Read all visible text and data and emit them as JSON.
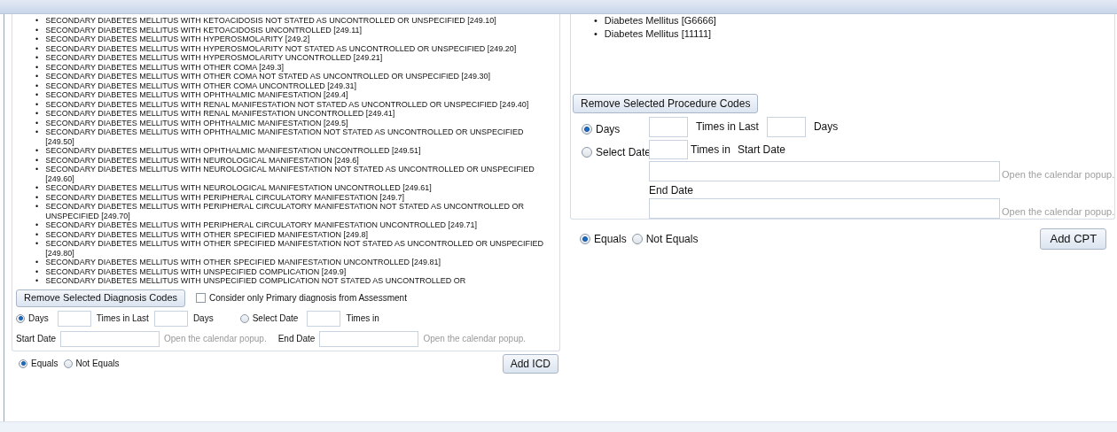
{
  "diagnosis_panel": {
    "codes": [
      {
        "marker": "•",
        "label": "SECONDARY DIABETES MELLITUS WITH KETOACIDOSIS NOT STATED AS UNCONTROLLED OR UNSPECIFIED [249.10]"
      },
      {
        "marker": "•",
        "label": "SECONDARY DIABETES MELLITUS WITH KETOACIDOSIS UNCONTROLLED [249.11]"
      },
      {
        "marker": "•",
        "label": "SECONDARY DIABETES MELLITUS WITH HYPEROSMOLARITY [249.2]"
      },
      {
        "marker": "•",
        "label": "SECONDARY DIABETES MELLITUS WITH HYPEROSMOLARITY NOT STATED AS UNCONTROLLED OR UNSPECIFIED [249.20]"
      },
      {
        "marker": "•",
        "label": "SECONDARY DIABETES MELLITUS WITH HYPEROSMOLARITY UNCONTROLLED [249.21]"
      },
      {
        "marker": "•",
        "label": "SECONDARY DIABETES MELLITUS WITH OTHER COMA [249.3]"
      },
      {
        "marker": "•",
        "label": "SECONDARY DIABETES MELLITUS WITH OTHER COMA NOT STATED AS UNCONTROLLED OR UNSPECIFIED [249.30]"
      },
      {
        "marker": "•",
        "label": "SECONDARY DIABETES MELLITUS WITH OTHER COMA UNCONTROLLED [249.31]"
      },
      {
        "marker": "•",
        "label": "SECONDARY DIABETES MELLITUS WITH OPHTHALMIC MANIFESTATION [249.4]"
      },
      {
        "marker": "•",
        "label": "SECONDARY DIABETES MELLITUS WITH RENAL MANIFESTATION NOT STATED AS UNCONTROLLED OR UNSPECIFIED [249.40]"
      },
      {
        "marker": "•",
        "label": "SECONDARY DIABETES MELLITUS WITH RENAL MANIFESTATION UNCONTROLLED [249.41]"
      },
      {
        "marker": "•",
        "label": "SECONDARY DIABETES MELLITUS WITH OPHTHALMIC MANIFESTATION [249.5]"
      },
      {
        "marker": "•",
        "label": "SECONDARY DIABETES MELLITUS WITH OPHTHALMIC MANIFESTATION NOT STATED AS UNCONTROLLED OR UNSPECIFIED [249.50]"
      },
      {
        "marker": "•",
        "label": "SECONDARY DIABETES MELLITUS WITH OPHTHALMIC MANIFESTATION UNCONTROLLED [249.51]"
      },
      {
        "marker": "•",
        "label": "SECONDARY DIABETES MELLITUS WITH NEUROLOGICAL MANIFESTATION [249.6]"
      },
      {
        "marker": "•",
        "label": "SECONDARY DIABETES MELLITUS WITH NEUROLOGICAL MANIFESTATION NOT STATED AS UNCONTROLLED OR UNSPECIFIED [249.60]"
      },
      {
        "marker": "•",
        "label": "SECONDARY DIABETES MELLITUS WITH NEUROLOGICAL MANIFESTATION UNCONTROLLED [249.61]"
      },
      {
        "marker": "•",
        "label": "SECONDARY DIABETES MELLITUS WITH PERIPHERAL CIRCULATORY MANIFESTATION [249.7]"
      },
      {
        "marker": "•",
        "label": "SECONDARY DIABETES MELLITUS WITH PERIPHERAL CIRCULATORY MANIFESTATION NOT STATED AS UNCONTROLLED OR UNSPECIFIED [249.70]"
      },
      {
        "marker": "•",
        "label": "SECONDARY DIABETES MELLITUS WITH PERIPHERAL CIRCULATORY MANIFESTATION UNCONTROLLED [249.71]"
      },
      {
        "marker": "•",
        "label": "SECONDARY DIABETES MELLITUS WITH OTHER SPECIFIED MANIFESTATION [249.8]"
      },
      {
        "marker": "•",
        "label": "SECONDARY DIABETES MELLITUS WITH OTHER SPECIFIED MANIFESTATION NOT STATED AS UNCONTROLLED OR UNSPECIFIED [249.80]"
      },
      {
        "marker": "•",
        "label": "SECONDARY DIABETES MELLITUS WITH OTHER SPECIFIED MANIFESTATION UNCONTROLLED [249.81]"
      },
      {
        "marker": "•",
        "label": "SECONDARY DIABETES MELLITUS WITH UNSPECIFIED COMPLICATION [249.9]"
      },
      {
        "marker": "•",
        "label": "SECONDARY DIABETES MELLITUS WITH UNSPECIFIED COMPLICATION NOT STATED AS UNCONTROLLED OR"
      }
    ],
    "remove_button": "Remove Selected Diagnosis Codes",
    "primary_only": {
      "label": "Consider only Primary diagnosis from Assessment",
      "checked": false
    },
    "frequency": {
      "modes": [
        {
          "label": "Days",
          "selected": true
        },
        {
          "label": "Select Date",
          "selected": false
        }
      ],
      "times_in_last": "Times in Last",
      "days_unit": "Days",
      "times_in": "Times in",
      "start_date": {
        "label": "Start Date",
        "link": "Open the calendar popup."
      },
      "end_date": {
        "label": "End Date",
        "link": "Open the calendar popup."
      }
    },
    "match": [
      {
        "label": "Equals",
        "selected": true
      },
      {
        "label": "Not Equals",
        "selected": false
      }
    ],
    "add_button": "Add ICD"
  },
  "procedure_panel": {
    "codes": [
      {
        "marker": "•",
        "label": "Diabetes Mellitus [G6666]"
      },
      {
        "marker": "•",
        "label": "Diabetes Mellitus [11111]"
      }
    ],
    "remove_button": "Remove Selected Procedure Codes",
    "frequency": {
      "modes": [
        {
          "label": "Days",
          "selected": true
        },
        {
          "label": "Select Date",
          "selected": false
        }
      ],
      "times_in_last": "Times in Last",
      "days_unit": "Days",
      "times_in": "Times in",
      "start_date": {
        "label": "Start Date",
        "link": "Open the calendar popup."
      },
      "end_date": {
        "label": "End Date",
        "link": "Open the calendar popup."
      }
    },
    "match": [
      {
        "label": "Equals",
        "selected": true
      },
      {
        "label": "Not Equals",
        "selected": false
      }
    ],
    "add_button": "Add CPT"
  }
}
